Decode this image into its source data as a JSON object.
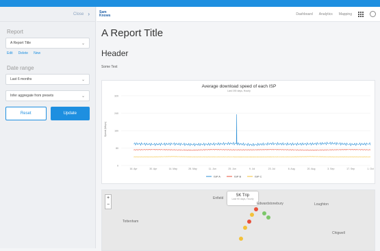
{
  "sidebar": {
    "close_label": "Close",
    "report_section": "Report",
    "report_select": "A Report Title",
    "actions": [
      "Edit",
      "Delete",
      "New"
    ],
    "date_section": "Date range",
    "date_select": "Last 6 months",
    "aggregate_select": "Infer aggregate from presets",
    "reset_label": "Reset",
    "update_label": "Update"
  },
  "navbar": {
    "logo_line1": "Sam",
    "logo_line2": "Knows",
    "links": [
      "Dashboard",
      "Analytics",
      "Mapping"
    ]
  },
  "main": {
    "title": "A Report Title",
    "header": "Header",
    "text": "Some Text"
  },
  "chart_data": {
    "type": "line",
    "title": "Average download speed of each ISP",
    "subtitle": "Last 190 days, Hourly",
    "ylabel": "Speed (Mbps)",
    "ylim": [
      0,
      320
    ],
    "yticks": [
      0,
      80,
      160,
      240,
      320
    ],
    "xticks": [
      "16. Apr",
      "30. Apr",
      "14. May",
      "28. May",
      "11. Jun",
      "25. Jun",
      "9. Jul",
      "23. Jul",
      "6. Aug",
      "20. Aug",
      "3. Sep",
      "17. Sep",
      "1. Oct"
    ],
    "legend_position": "bottom",
    "colors": {
      "ISP A": "#2b8fd6",
      "ISP B": "#e8503a",
      "ISP C": "#f3c13a"
    },
    "series": [
      {
        "name": "ISP A",
        "values": [
          100,
          97,
          99,
          96,
          98,
          101,
          95,
          100,
          98,
          99,
          102,
          97,
          99
        ],
        "spike": {
          "at": "25. Jun",
          "value": 235
        }
      },
      {
        "name": "ISP B",
        "values": [
          72,
          73,
          72,
          71,
          73,
          72,
          72,
          73,
          72,
          71,
          72,
          73,
          72
        ]
      },
      {
        "name": "ISP C",
        "values": [
          40,
          40,
          41,
          40,
          40,
          40,
          39,
          40,
          40,
          41,
          40,
          40,
          40
        ]
      }
    ]
  },
  "map": {
    "popup_title": "5K Trip",
    "popup_sub": "Last 90 days, Hourly",
    "places": [
      "Enfield",
      "Edwardstonebury",
      "Loughton",
      "Tottenham",
      "Chigwell"
    ]
  }
}
